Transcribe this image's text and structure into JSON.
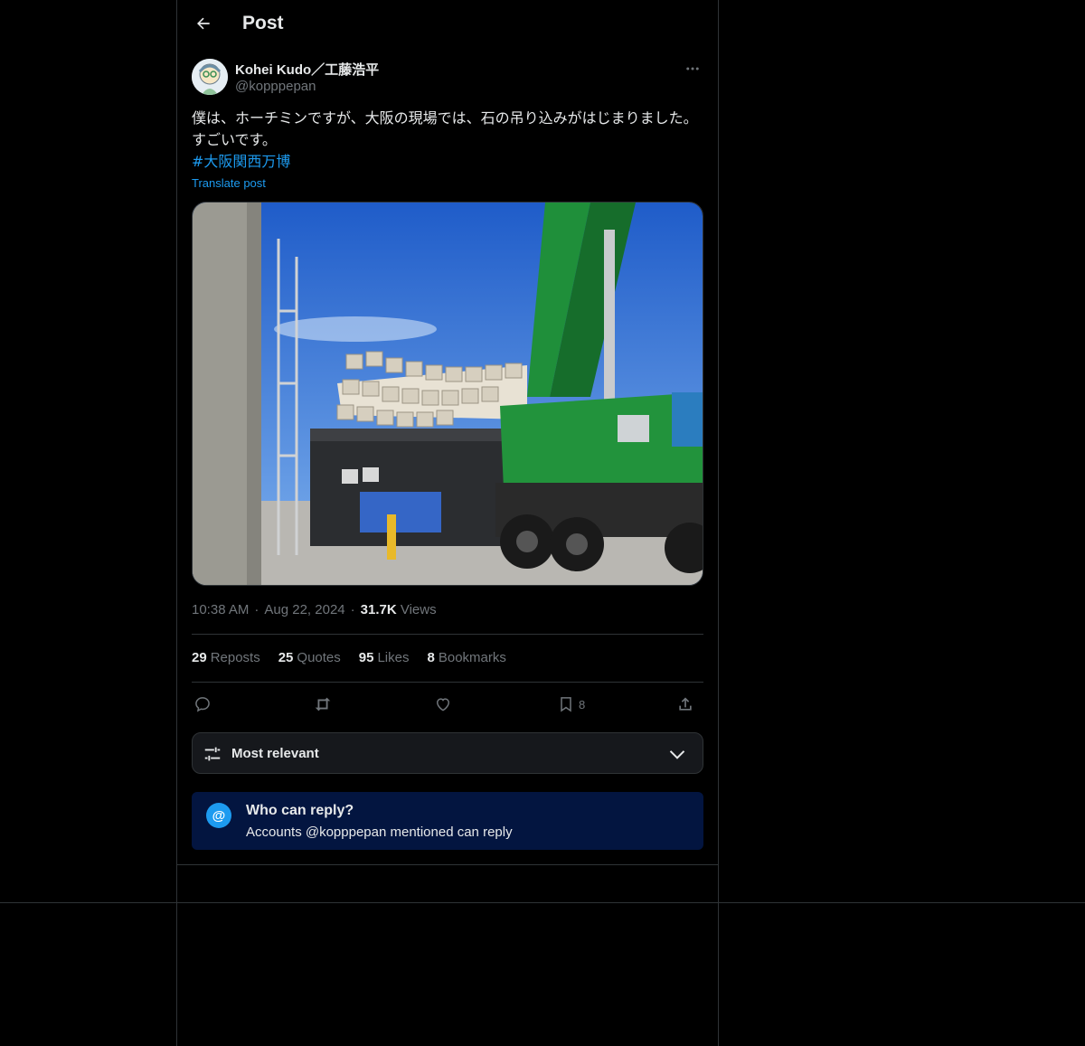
{
  "header": {
    "title": "Post"
  },
  "author": {
    "name": "Kohei Kudo／工藤浩平",
    "handle": "@kopppepan"
  },
  "tweet": {
    "text": "僕は、ホーチミンですが、大阪の現場では、石の吊り込みがはじまりました。すごいです。",
    "hashtag": "#大阪関西万博",
    "translate_label": "Translate post"
  },
  "meta": {
    "time": "10:38 AM",
    "date": "Aug 22, 2024",
    "views_count": "31.7K",
    "views_label": "Views"
  },
  "stats": {
    "reposts_count": "29",
    "reposts_label": "Reposts",
    "quotes_count": "25",
    "quotes_label": "Quotes",
    "likes_count": "95",
    "likes_label": "Likes",
    "bookmarks_count": "8",
    "bookmarks_label": "Bookmarks"
  },
  "actions": {
    "bookmark_count": "8"
  },
  "sort": {
    "label": "Most relevant"
  },
  "reply_restriction": {
    "icon": "@",
    "title": "Who can reply?",
    "subtitle": "Accounts @kopppepan mentioned can reply"
  },
  "colors": {
    "accent": "#1d9bf0",
    "crane": "#1f8f3a",
    "sky": "#2f6fd6"
  },
  "icons": [
    "back-arrow-icon",
    "more-icon",
    "reply-icon",
    "repost-icon",
    "like-icon",
    "bookmark-icon",
    "share-icon",
    "sliders-icon",
    "chevron-down-icon",
    "at-icon"
  ]
}
